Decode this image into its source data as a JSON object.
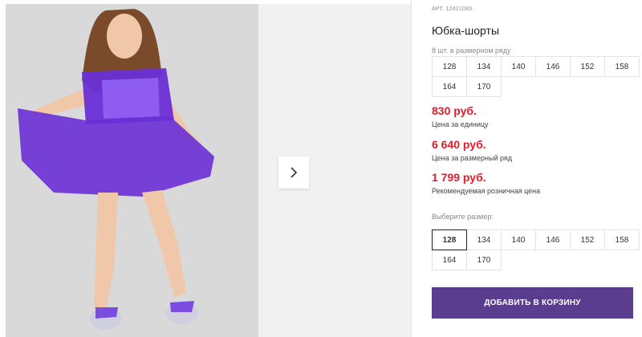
{
  "product": {
    "article_prefix": "АРТ.",
    "article_number": "12421083",
    "title": "Юбка-шорты"
  },
  "pack": {
    "note": "8 шт. в размерном ряду",
    "sizes": [
      "128",
      "134",
      "140",
      "146",
      "152",
      "158",
      "164",
      "170"
    ]
  },
  "prices": [
    {
      "value": "830 руб.",
      "label": "Цена за единицу"
    },
    {
      "value": "6 640 руб.",
      "label": "Цена за размерный ряд"
    },
    {
      "value": "1 799 руб.",
      "label": "Рекомендуемая розничная цена"
    }
  ],
  "size_select": {
    "label": "Выберите размер:",
    "sizes": [
      "128",
      "134",
      "140",
      "146",
      "152",
      "158",
      "164",
      "170"
    ],
    "selected": "128"
  },
  "cart": {
    "button_label": "ДОБАВИТЬ В КОРЗИНУ"
  },
  "gallery": {
    "next_icon": "chevron-right-icon",
    "photo_alt": "product-photo"
  },
  "colors": {
    "price": "#e11d2a",
    "button": "#5a3d8f",
    "product": "#6a2fd6"
  }
}
